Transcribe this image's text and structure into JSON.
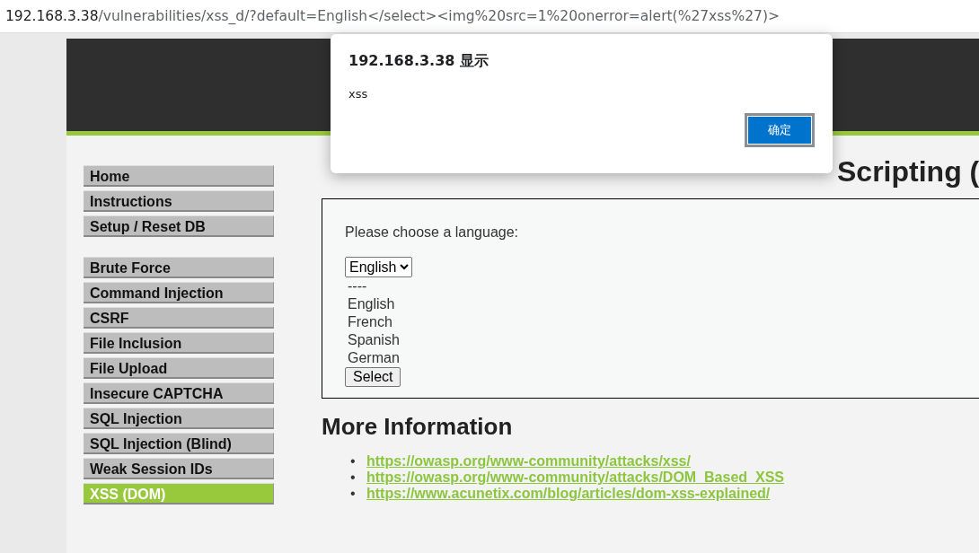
{
  "address_bar": {
    "host": "192.168.3.38",
    "path": "/vulnerabilities/xss_d/?default=English</select><img%20src=1%20onerror=alert(%27xss%27)>"
  },
  "sidebar": {
    "groups": [
      [
        {
          "label": "Home",
          "selected": false
        },
        {
          "label": "Instructions",
          "selected": false
        },
        {
          "label": "Setup / Reset DB",
          "selected": false
        }
      ],
      [
        {
          "label": "Brute Force",
          "selected": false
        },
        {
          "label": "Command Injection",
          "selected": false
        },
        {
          "label": "CSRF",
          "selected": false
        },
        {
          "label": "File Inclusion",
          "selected": false
        },
        {
          "label": "File Upload",
          "selected": false
        },
        {
          "label": "Insecure CAPTCHA",
          "selected": false
        },
        {
          "label": "SQL Injection",
          "selected": false
        },
        {
          "label": "SQL Injection (Blind)",
          "selected": false
        },
        {
          "label": "Weak Session IDs",
          "selected": false
        },
        {
          "label": "XSS (DOM)",
          "selected": true
        }
      ]
    ]
  },
  "heading": "Scripting (",
  "form": {
    "prompt": "Please choose a language:",
    "select_value": "English",
    "options": [
      "----",
      "English",
      "French",
      "Spanish",
      "German"
    ],
    "button": "Select"
  },
  "more_info": {
    "title": "More Information",
    "links": [
      {
        "bullet": "•",
        "url": "https://owasp.org/www-community/attacks/xss/"
      },
      {
        "bullet": "•",
        "url": "https://owasp.org/www-community/attacks/DOM_Based_XSS"
      },
      {
        "bullet": "•",
        "url": "https://www.acunetix.com/blog/articles/dom-xss-explained/"
      }
    ]
  },
  "dialog": {
    "title": "192.168.3.38 显示",
    "message": "xss",
    "button": "确定"
  }
}
